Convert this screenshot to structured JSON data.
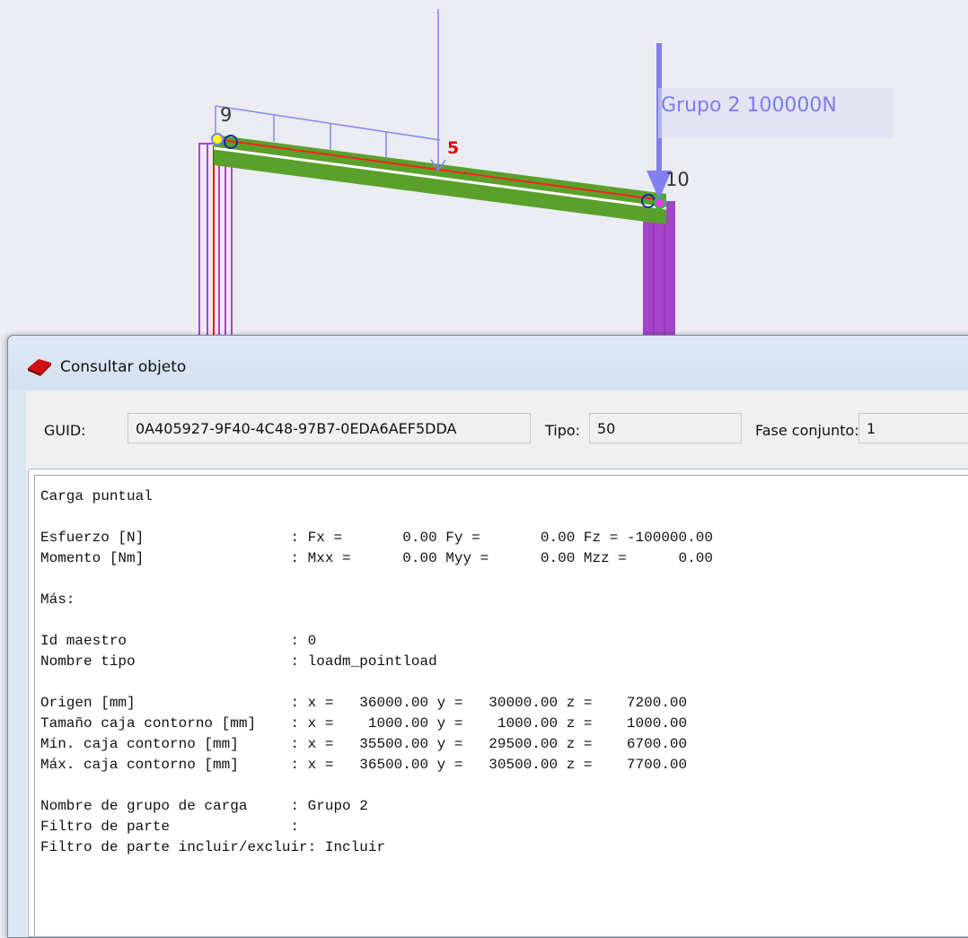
{
  "viewport": {
    "node_labels": [
      "9",
      "10"
    ],
    "load_number": "5",
    "group_label": "Grupo 2 100000N",
    "colors": {
      "beam": "#5aa02c",
      "column": "#a840c8",
      "load": "#8080f0",
      "load_label": "#e00000",
      "axis": "#ff0000",
      "background": "#ebecf1"
    }
  },
  "dialog": {
    "title": "Consultar objeto",
    "icon": "app-icon",
    "guid_label": "GUID:",
    "guid_value": "0A405927-9F40-4C48-97B7-0EDA6AEF5DDA",
    "tipo_label": "Tipo:",
    "tipo_value": "50",
    "fase_label": "Fase conjunto:",
    "fase_value": "1",
    "report_lines": [
      "Carga puntual",
      "",
      "Esfuerzo [N]                 : Fx =       0.00 Fy =       0.00 Fz = -100000.00",
      "Momento [Nm]                 : Mxx =      0.00 Myy =      0.00 Mzz =      0.00",
      "",
      "Más:",
      "",
      "Id maestro                   : 0",
      "Nombre tipo                  : loadm_pointload",
      "",
      "Origen [mm]                  : x =   36000.00 y =   30000.00 z =    7200.00",
      "Tamaño caja contorno [mm]    : x =    1000.00 y =    1000.00 z =    1000.00",
      "Mín. caja contorno [mm]      : x =   35500.00 y =   29500.00 z =    6700.00",
      "Máx. caja contorno [mm]      : x =   36500.00 y =   30500.00 z =    7700.00",
      "",
      "Nombre de grupo de carga     : Grupo 2",
      "Filtro de parte              :",
      "Filtro de parte incluir/excluir: Incluir"
    ]
  }
}
